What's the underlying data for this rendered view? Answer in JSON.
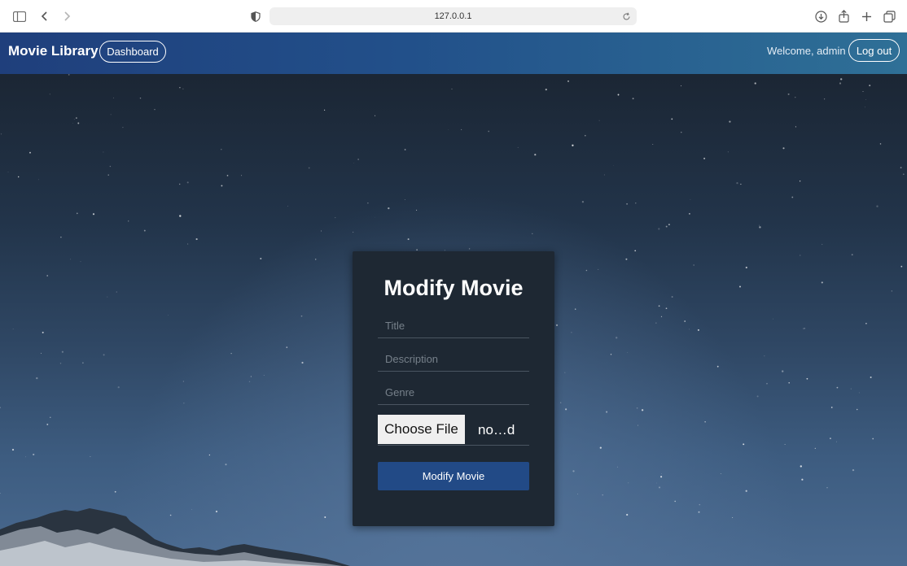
{
  "browser": {
    "url": "127.0.0.1",
    "icons": [
      "sidebar-toggle-icon",
      "back-icon",
      "forward-icon",
      "shield-icon",
      "reload-icon",
      "download-icon",
      "share-icon",
      "new-tab-icon",
      "tabs-overview-icon"
    ]
  },
  "navbar": {
    "brand": "Movie Library",
    "dashboard_label": "Dashboard",
    "welcome_text": "Welcome, admin",
    "logout_label": "Log out"
  },
  "form": {
    "title": "Modify Movie",
    "title_placeholder": "Title",
    "description_placeholder": "Description",
    "genre_placeholder": "Genre",
    "choose_file_label": "Choose File",
    "file_name": "no…d",
    "submit_label": "Modify Movie"
  },
  "colors": {
    "navbar_start": "#1f3f7c",
    "navbar_end": "#2f7097",
    "card_bg": "#1e2833",
    "submit_bg": "#224a86"
  }
}
